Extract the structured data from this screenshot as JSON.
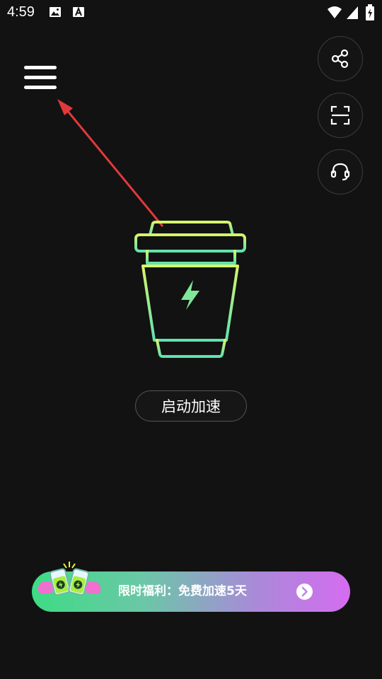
{
  "status_bar": {
    "time": "4:59",
    "left_icons": [
      "image-icon",
      "text-a-icon"
    ],
    "right_icons": [
      "wifi-icon",
      "signal-icon",
      "battery-charging-icon"
    ]
  },
  "header": {
    "menu_icon": "hamburger-menu-icon"
  },
  "side_actions": [
    {
      "name": "share",
      "icon": "share-icon"
    },
    {
      "name": "scan",
      "icon": "scan-frame-icon"
    },
    {
      "name": "support",
      "icon": "headset-icon"
    }
  ],
  "main": {
    "cup_icon": "coffee-cup-lightning-icon",
    "start_button_label": "启动加速"
  },
  "promo": {
    "text": "限时福利：免费加速5天",
    "arrow_icon": "chevron-right-icon"
  },
  "colors": {
    "background": "#121212",
    "cup_gradient_top": "#d6f56a",
    "cup_gradient_bottom": "#5fe3b0",
    "banner_start": "#3ddc84",
    "banner_end": "#d56cf0",
    "annotation_arrow": "#e0393c"
  }
}
